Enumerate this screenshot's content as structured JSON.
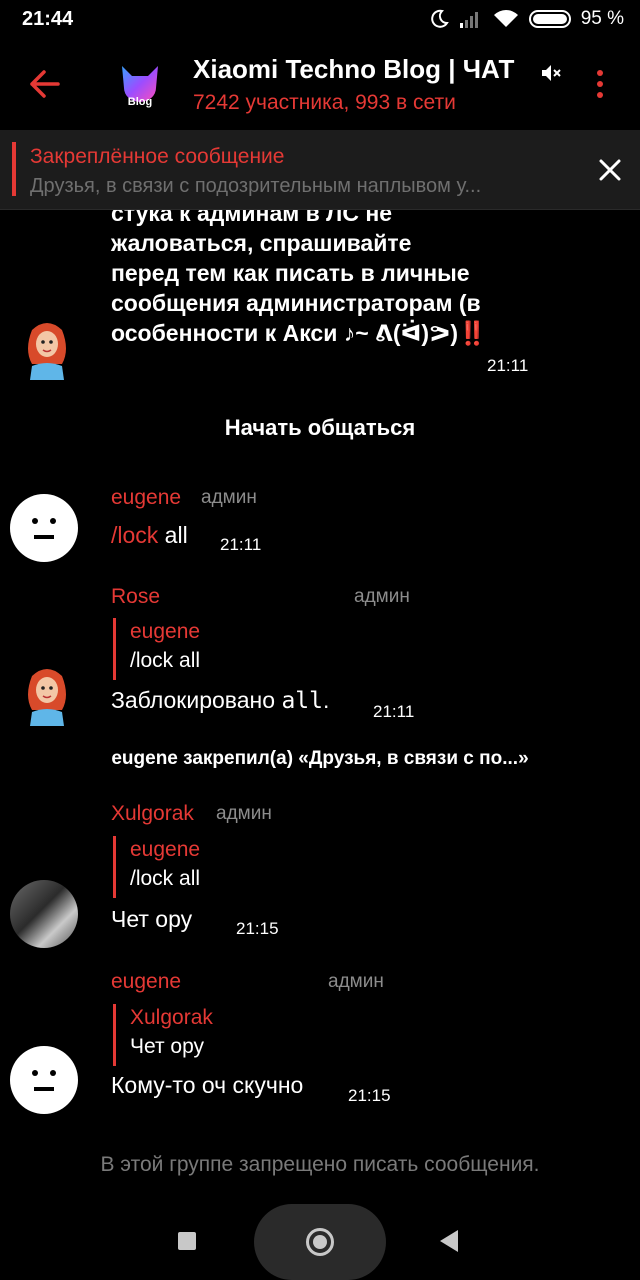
{
  "status_bar": {
    "time": "21:44",
    "battery": "95 %",
    "battery_level": 0.95
  },
  "header": {
    "title": "Xiaomi Techno Blog | ЧАТ",
    "subtitle": "7242 участника, 993 в сети",
    "logo_text": "Blog",
    "icons": {
      "back": "arrow-left-icon",
      "mute": "muted-speaker-icon",
      "menu": "more-vertical-icon"
    }
  },
  "pinned": {
    "title": "Закреплённое сообщение",
    "text": "Друзья, в связи с подозрительным наплывом у..."
  },
  "messages": {
    "first": {
      "lines": [
        "стука к админам в ЛС не",
        "жаловаться, спрашивайте",
        "перед тем как писать в личные",
        "сообщения администраторам (в",
        "особенности к Акси ♪~ ᕕ(ᐛ)ᕗ)‼️"
      ],
      "time": "21:11"
    },
    "start_btn": "Начать общаться",
    "m1": {
      "sender": "eugene",
      "role": "админ",
      "cmd": "/lock",
      "arg": " all",
      "time": "21:11"
    },
    "m2": {
      "sender": "Rose",
      "role": "админ",
      "quote_name": "eugene",
      "quote_text": "/lock all",
      "text": "Заблокировано ",
      "code": "all",
      "text_end": ".",
      "time": "21:11"
    },
    "service": "eugene закрепил(а) «Друзья, в связи с по...»",
    "m3": {
      "sender": "Xulgorak",
      "role": "админ",
      "quote_name": "eugene",
      "quote_text": "/lock all",
      "text": "Чет ору",
      "time": "21:15"
    },
    "m4": {
      "sender": "eugene",
      "role": "админ",
      "quote_name": "Xulgorak",
      "quote_text": "Чет ору",
      "text": "Кому-то оч скучно",
      "time": "21:15"
    }
  },
  "footer": "В этой группе запрещено писать сообщения."
}
